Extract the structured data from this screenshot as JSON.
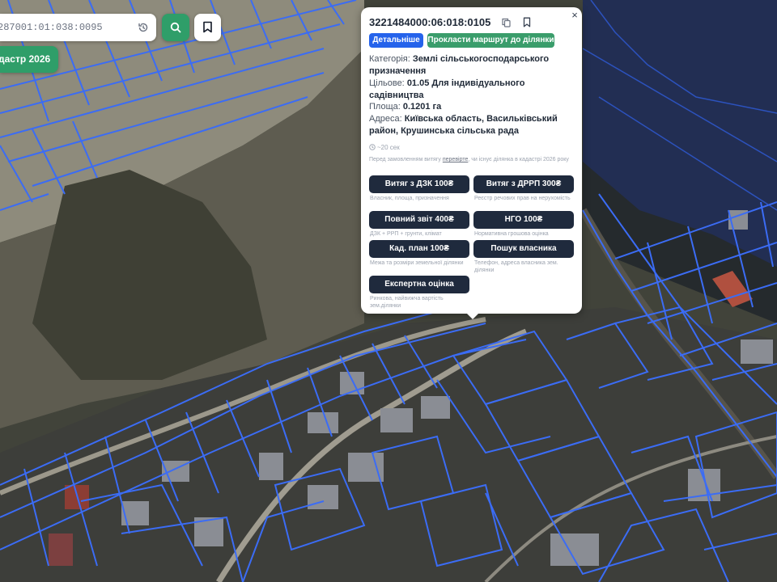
{
  "search": {
    "value": "287001:01:038:0095"
  },
  "cadastre_chip": {
    "label": "дастр 2026"
  },
  "popup": {
    "parcel_id": "3221484000:06:018:0105",
    "details_label": "Детальніше",
    "route_label": "Прокласти маршрут до ділянки",
    "close_glyph": "×",
    "category_label": "Категорія: ",
    "category_value": "Землі сільськогосподарського призначення",
    "purpose_label": "Цільове: ",
    "purpose_value": "01.05 Для індивідуального садівництва",
    "area_label": "Площа: ",
    "area_value": "0.1201 га",
    "address_label": "Адреса: ",
    "address_value": "Київська область, Васильківський район, Крушинська сільська рада",
    "timer": "~20 сек",
    "note_before": "Перед замовленням витягу ",
    "note_link": "перевірте",
    "note_after": ", чи існує ділянка в кадастрі 2026 року",
    "documents": [
      {
        "label": "Витяг з ДЗК 100₴",
        "caption": "Власник, площа, призначення"
      },
      {
        "label": "Витяг з ДРРП 300₴",
        "caption": "Реєстр речових прав на нерухомість"
      },
      {
        "label": "Повний звіт 400₴",
        "caption": "ДЗК + РРП + грунти, клімат"
      },
      {
        "label": "НГО 100₴",
        "caption": "Нормативна грошова оцінка"
      },
      {
        "label": "Кад. план 100₴",
        "caption": "Межа та розміри земельної ділянки"
      },
      {
        "label": "Пошук власника",
        "caption": "Телефон, адреса власника зем. ділянки"
      },
      {
        "label": "Експертна оцінка",
        "caption": "Ринкова, найвижча вартість зем.ділянки"
      }
    ]
  },
  "colors": {
    "accent_green": "#2f9e69",
    "accent_blue": "#2563eb",
    "dark_button": "#1f2a3d",
    "parcel_line": "#3b6cf5"
  },
  "icons": [
    "history-icon",
    "search-icon",
    "bookmark-icon",
    "copy-icon",
    "close-icon",
    "clock-icon"
  ]
}
